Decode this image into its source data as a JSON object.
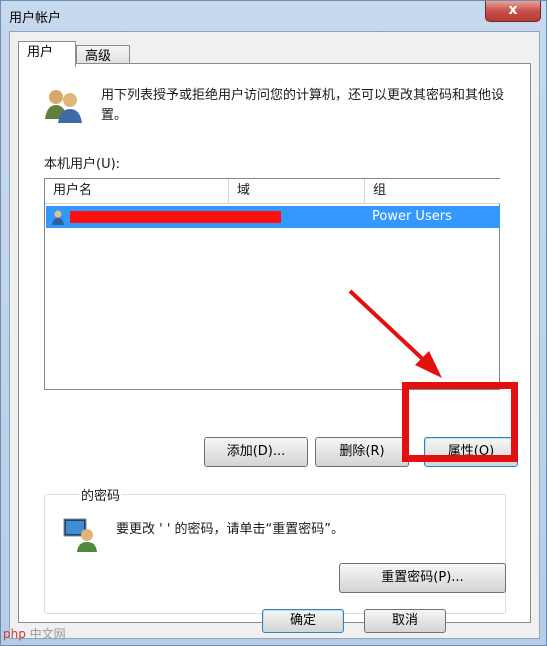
{
  "window": {
    "title": "用户帐户",
    "close_glyph": "x"
  },
  "tabs": [
    {
      "label": "用户",
      "active": true
    },
    {
      "label": "高级",
      "active": false
    }
  ],
  "description": "用下列表授予或拒绝用户访问您的计算机，还可以更改其密码和其他设置。",
  "user_list": {
    "label": "本机用户(U):",
    "columns": [
      "用户名",
      "域",
      "组"
    ],
    "rows": [
      {
        "username": "",
        "domain": "",
        "group": "Power Users",
        "selected": true
      }
    ]
  },
  "buttons": {
    "add": "添加(D)...",
    "remove": "删除(R)",
    "properties": "属性(O)"
  },
  "password_group": {
    "title": "的密码",
    "text": "要更改 '   ' 的密码，请单击“重置密码”。",
    "reset_button": "重置密码(P)..."
  },
  "footer": {
    "ok": "确定",
    "cancel": "取消"
  },
  "watermark": {
    "brand": "php",
    "site": "中文网"
  },
  "colors": {
    "selection": "#3399ff",
    "annotation": "#e31010"
  }
}
